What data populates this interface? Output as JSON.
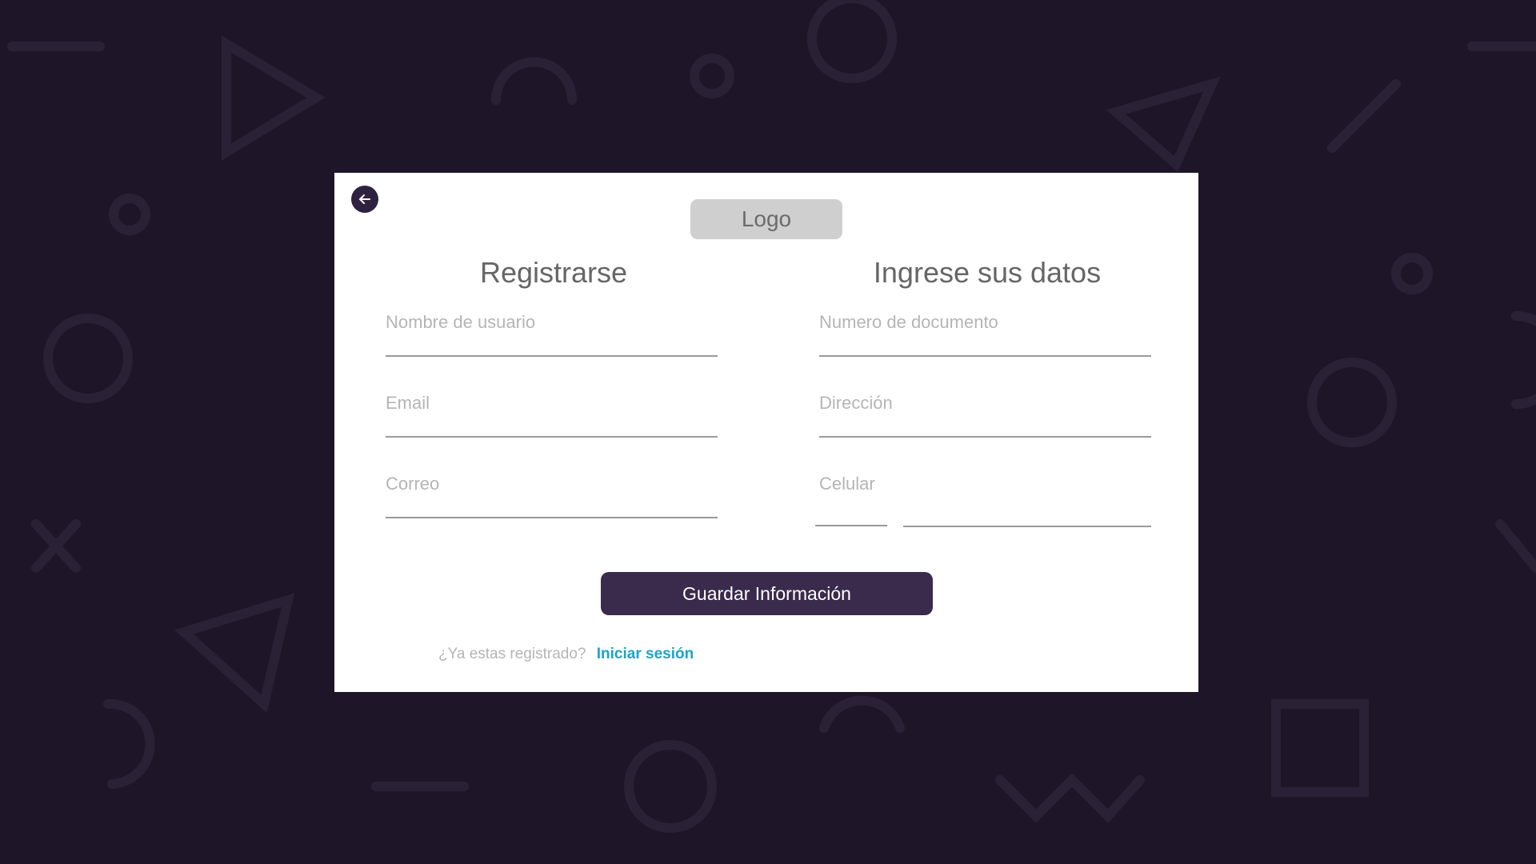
{
  "colors": {
    "background": "#1e1628",
    "card": "#ffffff",
    "primary_button": "#3a2a4c",
    "link": "#1aa4c8",
    "placeholder_text": "#b5b5b5",
    "title_text": "#666666"
  },
  "header": {
    "back_icon": "arrow-left-icon",
    "logo_text": "Logo"
  },
  "left_section": {
    "title": "Registrarse",
    "fields": [
      {
        "label": "Nombre de usuario"
      },
      {
        "label": "Email"
      },
      {
        "label": "Correo"
      }
    ]
  },
  "right_section": {
    "title": "Ingrese sus datos",
    "fields": [
      {
        "label": "Numero de documento"
      },
      {
        "label": "Dirección"
      },
      {
        "label": "Celular"
      }
    ]
  },
  "actions": {
    "save_label": "Guardar Información"
  },
  "footer": {
    "question": "¿Ya estas registrado?",
    "login_link": "Iniciar sesión"
  }
}
